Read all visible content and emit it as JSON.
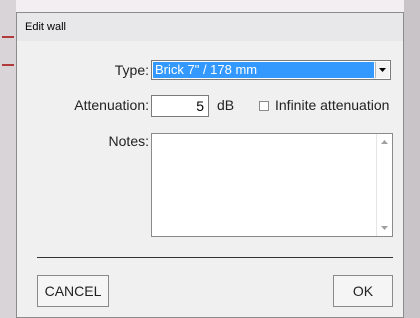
{
  "dialog": {
    "title": "Edit wall",
    "type_label": "Type:",
    "type_value": "Brick 7\" / 178 mm",
    "attenuation_label": "Attenuation:",
    "attenuation_value": "5",
    "attenuation_unit": "dB",
    "infinite_label": "Infinite attenuation",
    "infinite_checked": false,
    "notes_label": "Notes:",
    "notes_value": "",
    "cancel_label": "CANCEL",
    "ok_label": "OK"
  },
  "colors": {
    "selection": "#3399ff",
    "dialog_bg": "#f0f0f0"
  },
  "icons": [
    "chevron-down-icon",
    "scroll-up-icon",
    "scroll-down-icon"
  ]
}
